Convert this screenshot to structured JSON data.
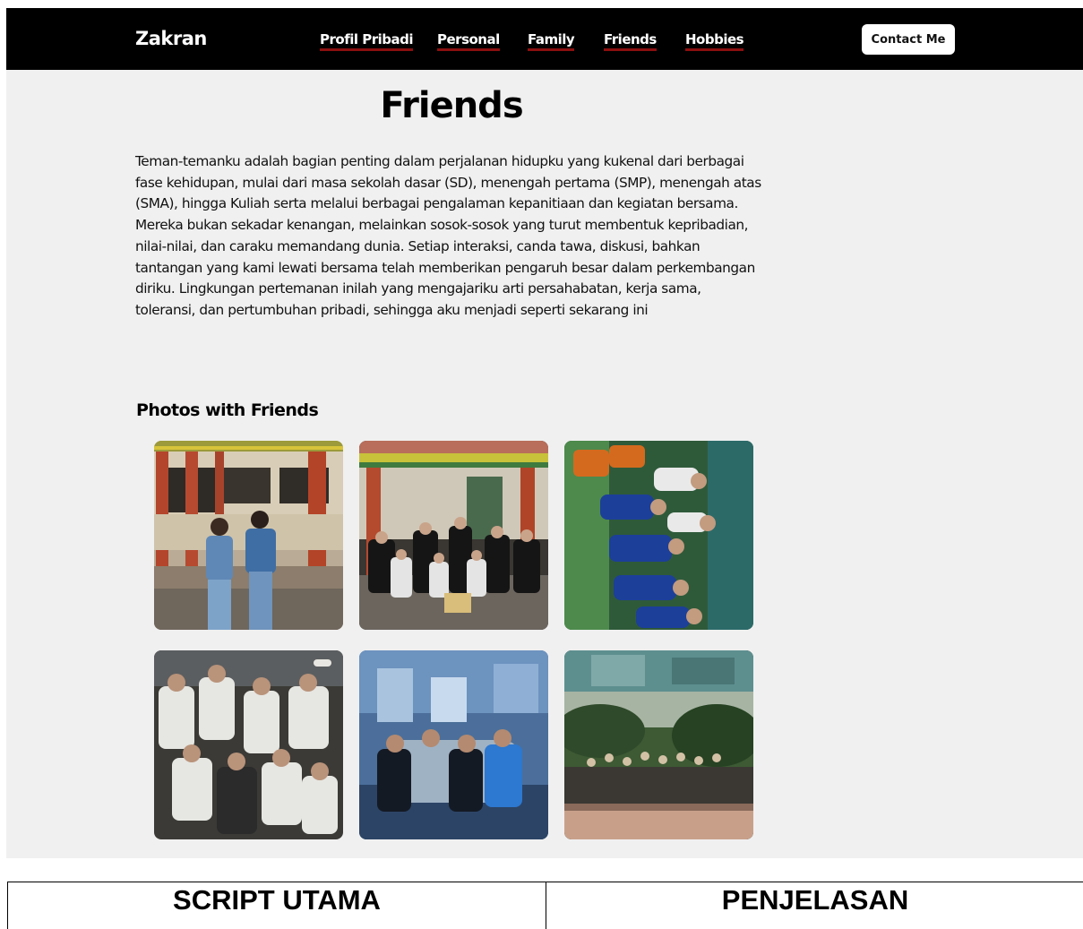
{
  "navbar": {
    "brand": "Zakran",
    "links": [
      "Profil Pribadi",
      "Personal",
      "Family",
      "Friends",
      "Hobbies"
    ],
    "contact_button": "Contact Me",
    "background": "#000000",
    "underline_color": "#8b0f0f"
  },
  "main": {
    "title": "Friends",
    "intro": "Teman-temanku adalah bagian penting dalam perjalanan hidupku yang kukenal dari berbagai fase kehidupan, mulai dari masa sekolah dasar (SD), menengah pertama (SMP), menengah atas (SMA), hingga Kuliah serta melalui berbagai pengalaman kepanitiaan dan kegiatan bersama. Mereka bukan sekadar kenangan, melainkan sosok-sosok yang turut membentuk kepribadian, nilai-nilai, dan caraku memandang dunia. Setiap interaksi, canda tawa, diskusi, bahkan tantangan yang kami lewati bersama telah memberikan pengaruh besar dalam perkembangan diriku. Lingkungan pertemanan inilah yang mengajariku arti persahabatan, kerja sama, toleransi, dan pertumbuhan pribadi, sehingga aku menjadi seperti sekarang ini",
    "gallery_title": "Photos with Friends"
  },
  "doc_table": {
    "headers": [
      "SCRIPT UTAMA",
      "PENJELASAN"
    ]
  }
}
